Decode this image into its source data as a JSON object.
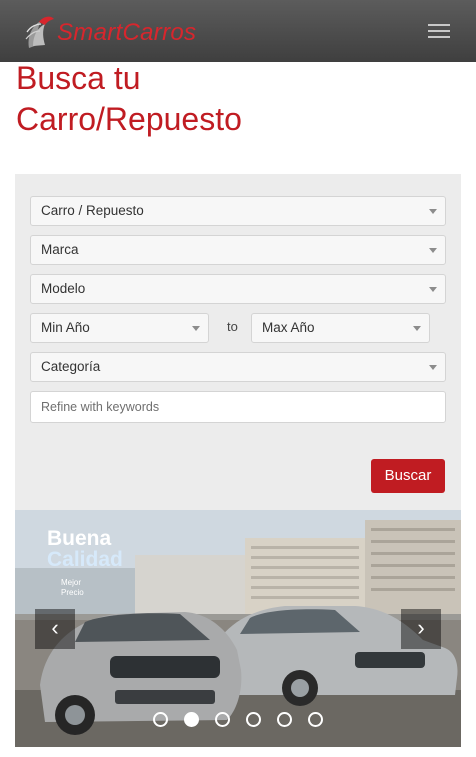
{
  "header": {
    "brand": "SmartCarros",
    "menu_icon": "hamburger-menu-icon",
    "brand_color": "#d7262d"
  },
  "title": {
    "line1": "Busca tu",
    "line2": "Carro/Repuesto"
  },
  "search": {
    "type_select": "Carro / Repuesto",
    "brand_select": "Marca",
    "model_select": "Modelo",
    "min_year_select": "Min Año",
    "range_separator": "to",
    "max_year_select": "Max Año",
    "category_select": "Categoría",
    "keywords_placeholder": "Refine with keywords",
    "keywords_value": "",
    "submit_label": "Buscar"
  },
  "carousel": {
    "caption_line1": "Buena",
    "caption_line2": "Calidad",
    "caption_line3": "Mejor",
    "caption_line4": "Precio",
    "prev_icon": "chevron-left-icon",
    "next_icon": "chevron-right-icon",
    "prev_glyph": "‹",
    "next_glyph": "›",
    "slide_count": 6,
    "active_slide": 2
  },
  "colors": {
    "accent": "#c01c22",
    "navbar": "#4a4a4a",
    "panel": "#ececec"
  }
}
